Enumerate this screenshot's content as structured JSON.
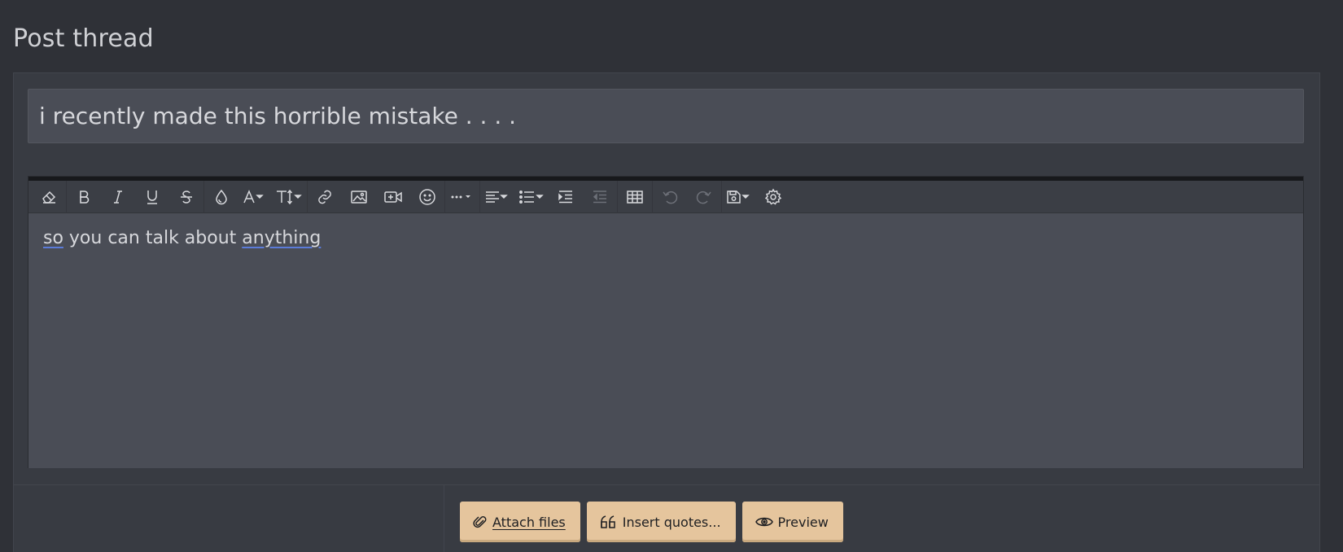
{
  "page": {
    "title": "Post thread"
  },
  "thread": {
    "title_value": "i recently made this horrible mistake . . . .",
    "body_words": [
      "so",
      " you can talk about ",
      "anything"
    ]
  },
  "toolbar": {
    "items": [
      {
        "name": "remove-format",
        "icon": "eraser-icon"
      },
      {
        "name": "bold",
        "icon": "bold-icon"
      },
      {
        "name": "italic",
        "icon": "italic-icon"
      },
      {
        "name": "underline",
        "icon": "underline-icon"
      },
      {
        "name": "strikethrough",
        "icon": "strikethrough-icon"
      },
      {
        "name": "text-color",
        "icon": "droplet-icon"
      },
      {
        "name": "font-family",
        "icon": "font-icon"
      },
      {
        "name": "font-size",
        "icon": "font-size-icon"
      },
      {
        "name": "link",
        "icon": "link-icon"
      },
      {
        "name": "image",
        "icon": "image-icon"
      },
      {
        "name": "media",
        "icon": "video-icon"
      },
      {
        "name": "smilies",
        "icon": "smiley-icon"
      },
      {
        "name": "more",
        "icon": "ellipsis-icon"
      },
      {
        "name": "align",
        "icon": "align-icon"
      },
      {
        "name": "list",
        "icon": "list-icon"
      },
      {
        "name": "indent",
        "icon": "indent-icon"
      },
      {
        "name": "outdent",
        "icon": "outdent-icon"
      },
      {
        "name": "table",
        "icon": "table-icon"
      },
      {
        "name": "undo",
        "icon": "undo-icon"
      },
      {
        "name": "redo",
        "icon": "redo-icon"
      },
      {
        "name": "drafts",
        "icon": "save-icon"
      },
      {
        "name": "options",
        "icon": "gear-icon"
      }
    ]
  },
  "actions": {
    "attach_label": "Attach files",
    "quotes_label": "Insert quotes...",
    "preview_label": "Preview"
  },
  "colors": {
    "background": "#2f3137",
    "panel": "#383b42",
    "input": "#4a4d56",
    "button": "#e5c59d",
    "spellcheck": "#5b7bd9"
  }
}
